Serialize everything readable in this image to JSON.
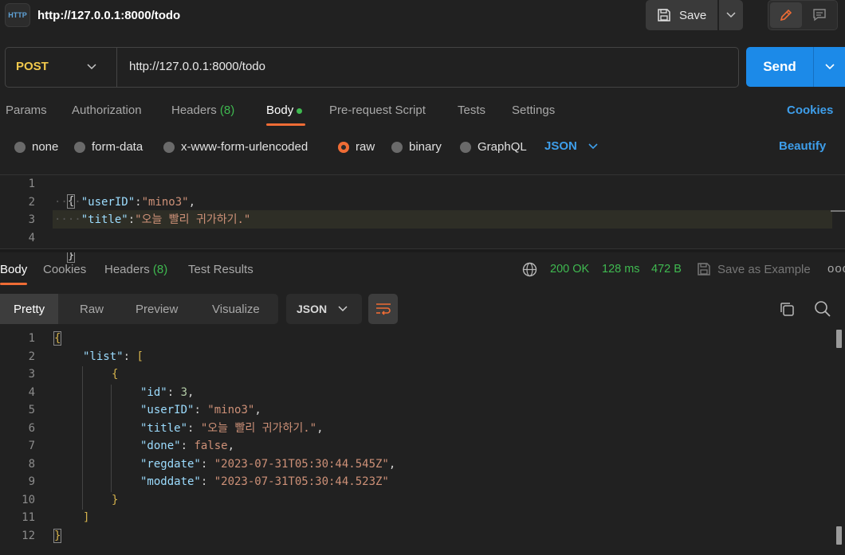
{
  "header": {
    "badge": "HTTP",
    "title": "http://127.0.0.1:8000/todo",
    "save_label": "Save"
  },
  "request": {
    "method": "POST",
    "url": "http://127.0.0.1:8000/todo",
    "send_label": "Send"
  },
  "request_tabs": {
    "params": "Params",
    "authorization": "Authorization",
    "headers": "Headers",
    "headers_count": "(8)",
    "body": "Body",
    "pre_request": "Pre-request Script",
    "tests": "Tests",
    "settings": "Settings",
    "cookies": "Cookies"
  },
  "body_types": {
    "none": "none",
    "form_data": "form-data",
    "urlencoded": "x-www-form-urlencoded",
    "raw": "raw",
    "binary": "binary",
    "graphql": "GraphQL",
    "format": "JSON",
    "beautify": "Beautify",
    "selected": "raw"
  },
  "request_body": {
    "line_numbers": [
      "1",
      "2",
      "3",
      "4"
    ],
    "l1": "{",
    "l2_key": "\"userID\"",
    "l2_colon": ":",
    "l2_val": "\"mino3\"",
    "l2_comma": ",",
    "l3_key": "\"title\"",
    "l3_colon": ":",
    "l3_val": "\"오늘 빨리 귀가하기.\"",
    "l4": "}"
  },
  "response_tabs": {
    "body": "Body",
    "cookies": "Cookies",
    "headers": "Headers",
    "headers_count": "(8)",
    "test_results": "Test Results"
  },
  "response_status": {
    "status": "200 OK",
    "time": "128 ms",
    "size": "472 B",
    "save_example": "Save as Example",
    "more": "ooo"
  },
  "response_view": {
    "pretty": "Pretty",
    "raw": "Raw",
    "preview": "Preview",
    "visualize": "Visualize",
    "format": "JSON"
  },
  "response_body": {
    "line_numbers": [
      "1",
      "2",
      "3",
      "4",
      "5",
      "6",
      "7",
      "8",
      "9",
      "10",
      "11",
      "12"
    ],
    "open": "{",
    "list_key": "\"list\"",
    "list_open": "[",
    "obj_open": "{",
    "id_key": "\"id\"",
    "id_val": "3",
    "userid_key": "\"userID\"",
    "userid_val": "\"mino3\"",
    "title_key": "\"title\"",
    "title_val": "\"오늘 빨리 귀가하기.\"",
    "done_key": "\"done\"",
    "done_val": "false",
    "regdate_key": "\"regdate\"",
    "regdate_val": "\"2023-07-31T05:30:44.545Z\"",
    "moddate_key": "\"moddate\"",
    "moddate_val": "\"2023-07-31T05:30:44.523Z\"",
    "obj_close": "}",
    "list_close": "]",
    "close": "}"
  }
}
